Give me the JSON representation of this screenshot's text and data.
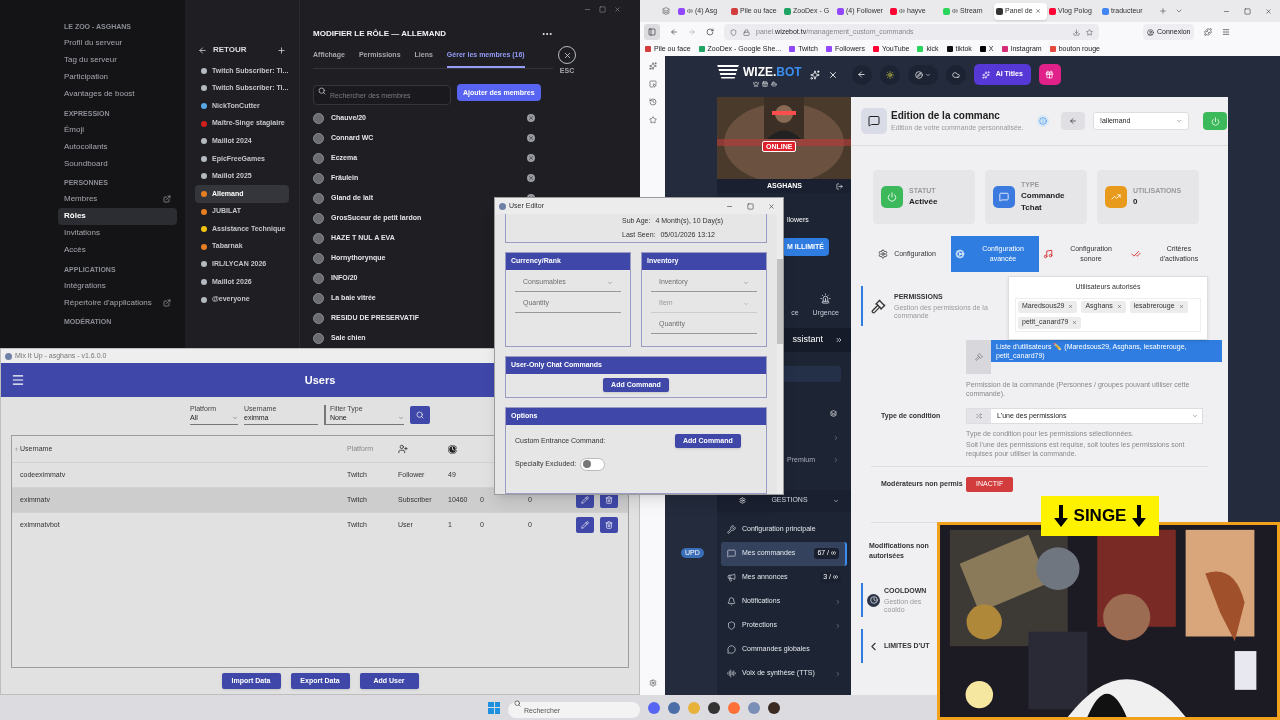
{
  "discord": {
    "sections": [
      {
        "title": "LE ZOO - ASGHANS",
        "items": [
          {
            "label": "Profil du serveur",
            "selected": false,
            "external": false
          },
          {
            "label": "Tag du serveur",
            "selected": false,
            "external": false
          },
          {
            "label": "Participation",
            "selected": false,
            "external": false
          },
          {
            "label": "Avantages de boost",
            "selected": false,
            "external": false
          }
        ]
      },
      {
        "title": "EXPRESSION",
        "items": [
          {
            "label": "Émoji",
            "selected": false,
            "external": false
          },
          {
            "label": "Autocollants",
            "selected": false,
            "external": false
          },
          {
            "label": "Soundboard",
            "selected": false,
            "external": false
          }
        ]
      },
      {
        "title": "PERSONNES",
        "items": [
          {
            "label": "Membres",
            "selected": false,
            "external": true
          },
          {
            "label": "Rôles",
            "selected": true,
            "external": false
          },
          {
            "label": "Invitations",
            "selected": false,
            "external": false
          },
          {
            "label": "Accès",
            "selected": false,
            "external": false
          }
        ]
      },
      {
        "title": "APPLICATIONS",
        "items": [
          {
            "label": "Intégrations",
            "selected": false,
            "external": false
          },
          {
            "label": "Répertoire d'applications",
            "selected": false,
            "external": true
          }
        ]
      },
      {
        "title": "MODÉRATION"
      }
    ],
    "back_label": "RETOUR",
    "roles": [
      {
        "name": "Twitch Subscriber: Ti...",
        "color": "#b5bac1",
        "selected": false
      },
      {
        "name": "Twitch Subscriber: Ti...",
        "color": "#b5bac1",
        "selected": false
      },
      {
        "name": "NickTonCutter",
        "color": "#5aa9e6",
        "selected": false
      },
      {
        "name": "Maître-Singe stagiaire",
        "color": "#d41f1f",
        "selected": false
      },
      {
        "name": "Maillot 2024",
        "color": "#b5bac1",
        "selected": false
      },
      {
        "name": "EpicFreeGames",
        "color": "#b5bac1",
        "selected": false
      },
      {
        "name": "Maillot 2025",
        "color": "#b5bac1",
        "selected": false
      },
      {
        "name": "Allemand",
        "color": "#e67e22",
        "selected": true
      },
      {
        "name": "JUBILAT",
        "color": "#e67e22",
        "selected": false
      },
      {
        "name": "Assistance Technique",
        "color": "#f1c40f",
        "selected": false
      },
      {
        "name": "Tabarnak",
        "color": "#e67e22",
        "selected": false
      },
      {
        "name": "IRL/LYCAN 2026",
        "color": "#b5bac1",
        "selected": false
      },
      {
        "name": "Maillot 2026",
        "color": "#b5bac1",
        "selected": false
      },
      {
        "name": "@everyone",
        "color": "#b5bac1",
        "selected": false
      }
    ],
    "editor": {
      "title": "MODIFIER LE RÔLE — ALLEMAND",
      "tabs": [
        {
          "label": "Affichage",
          "selected": false
        },
        {
          "label": "Permissions",
          "selected": false
        },
        {
          "label": "Liens",
          "selected": false
        },
        {
          "label": "Gérer les membres (16)",
          "selected": true
        }
      ],
      "close_hint": "ESC",
      "search": {
        "placeholder": "Rechercher des membres"
      },
      "add_button": "Ajouter des membres",
      "members": [
        {
          "name": "Chauve/20",
          "remove_button": true
        },
        {
          "name": "Connard WC",
          "remove_button": true
        },
        {
          "name": "Eczema",
          "remove_button": true
        },
        {
          "name": "Fräulein",
          "remove_button": true
        },
        {
          "name": "Gland de lait",
          "remove_button": true
        },
        {
          "name": "GrosSuceur de petit lardon",
          "remove_button": false
        },
        {
          "name": "HAZE T NUL A EVA",
          "remove_button": false
        },
        {
          "name": "Hornythorynque",
          "remove_button": false
        },
        {
          "name": "INFO/20",
          "remove_button": false
        },
        {
          "name": "La baie vitrée",
          "remove_button": false
        },
        {
          "name": "RESIDU DE PRESERVATIF",
          "remove_button": false
        },
        {
          "name": "Sale chien",
          "remove_button": false
        }
      ]
    }
  },
  "mixitup": {
    "title": "Mix It Up - asghans - v1.6.0.0",
    "header": "Users",
    "filters": [
      {
        "label": "Platform",
        "value": "All",
        "kind": "select"
      },
      {
        "label": "Username",
        "value": "eximma",
        "kind": "text"
      },
      {
        "label": "Filter Type",
        "value": "None",
        "kind": "select"
      }
    ],
    "columns": [
      {
        "kind": "text",
        "label": "Username"
      },
      {
        "kind": "text",
        "label": "Platform"
      },
      {
        "kind": "follow-icon"
      },
      {
        "kind": "clock-icon"
      }
    ],
    "rows": [
      {
        "selected": false,
        "actions": false,
        "cells": [
          "codeeximmatv",
          "Twitch",
          "Follower",
          "49"
        ]
      },
      {
        "selected": true,
        "actions": true,
        "cells": [
          "eximmatv",
          "Twitch",
          "Subscriber",
          "10460",
          "0",
          "0"
        ]
      },
      {
        "selected": false,
        "actions": true,
        "cells": [
          "eximmatvbot",
          "Twitch",
          "User",
          "1",
          "0",
          "0"
        ]
      }
    ],
    "buttons": [
      "Import Data",
      "Export Data",
      "Add User"
    ]
  },
  "user_editor": {
    "title": "User Editor",
    "details": [
      {
        "label": "Sub Age:",
        "value": "4 Month(s), 10 Day(s)"
      },
      {
        "label": "Last Seen:",
        "value": "05/01/2026 13:12"
      }
    ],
    "panels": [
      {
        "title": "Currency/Rank",
        "fields": [
          {
            "kind": "select",
            "placeholder": "Consumables",
            "disabled": false
          },
          {
            "kind": "text",
            "placeholder": "Quantity",
            "disabled": false
          }
        ]
      },
      {
        "title": "Inventory",
        "fields": [
          {
            "kind": "select",
            "placeholder": "Inventory",
            "disabled": false
          },
          {
            "kind": "select",
            "placeholder": "Item",
            "disabled": true
          },
          {
            "kind": "text",
            "placeholder": "Quantity",
            "disabled": false
          }
        ]
      }
    ],
    "chat_commands": {
      "title": "User-Only Chat Commands",
      "button": "Add Command"
    },
    "options": {
      "title": "Options",
      "rows": [
        {
          "kind": "button",
          "label": "Custom Entrance Command:",
          "button": "Add Command"
        },
        {
          "kind": "toggle",
          "label": "Specialty Excluded:",
          "on": false
        }
      ]
    }
  },
  "browser": {
    "tabs": [
      {
        "label": "(4) Asg",
        "color": "#9146ff",
        "audio": true,
        "selected": false
      },
      {
        "label": "Pile ou face",
        "color": "#d33c3c",
        "audio": false,
        "selected": false
      },
      {
        "label": "ZooDex - G",
        "color": "#1fa463",
        "audio": false,
        "selected": false
      },
      {
        "label": "(4) Follower",
        "color": "#9146ff",
        "audio": false,
        "selected": false
      },
      {
        "label": "hayve",
        "color": "#ff0033",
        "audio": true,
        "selected": false
      },
      {
        "label": "Stream",
        "color": "#2bd45a",
        "audio": true,
        "selected": false
      },
      {
        "label": "Panel de",
        "color": "#333333",
        "audio": false,
        "selected": true
      },
      {
        "label": "Vlog Polog",
        "color": "#ff0033",
        "audio": false,
        "selected": false
      },
      {
        "label": "traducteur",
        "color": "#4285f4",
        "audio": false,
        "selected": false
      }
    ],
    "address": "panel.**wizebot.tv**/management_custom_commands",
    "account": "Connexion",
    "bookmarks": [
      {
        "label": "Pile ou face",
        "color": "#d33c3c"
      },
      {
        "label": "ZooDex - Google She...",
        "color": "#1fa463"
      },
      {
        "label": "Twitch",
        "color": "#9146ff"
      },
      {
        "label": "Followers",
        "color": "#9146ff"
      },
      {
        "label": "YouTube",
        "color": "#ff0033"
      },
      {
        "label": "kick",
        "color": "#2bd45a"
      },
      {
        "label": "tiktok",
        "color": "#111111"
      },
      {
        "label": "X",
        "color": "#000000"
      },
      {
        "label": "Instagram",
        "color": "#d62976"
      },
      {
        "label": "bouton rouge",
        "color": "#e5483f"
      }
    ]
  },
  "wizebot": {
    "logo": {
      "main": "WIZE.",
      "accent": "BOT"
    },
    "ai_button": "AI Titles",
    "profile": {
      "status": "ONLINE",
      "name": "ASGHANS",
      "followers": "llowers",
      "plan": "M ILLIMITÉ",
      "shortcuts": [
        "ce",
        "Urgence"
      ],
      "assistant": "ssistant",
      "premium": "Premium"
    },
    "upd_badge": "UPD",
    "menu": {
      "section": "GESTIONS",
      "items": [
        {
          "kind": "wrench",
          "label": "Configuration principale",
          "selected": false,
          "chevron": false
        },
        {
          "kind": "message",
          "label": "Mes commandes",
          "count": "67 / ∞",
          "selected": true,
          "chevron": false
        },
        {
          "kind": "megaphone",
          "label": "Mes annonces",
          "count": "3 / ∞",
          "selected": false,
          "chevron": false
        },
        {
          "kind": "bell",
          "label": "Notifications",
          "selected": false,
          "chevron": true
        },
        {
          "kind": "shield",
          "label": "Protections",
          "selected": false,
          "chevron": true
        },
        {
          "kind": "chat",
          "label": "Commandes globales",
          "selected": false,
          "chevron": false
        },
        {
          "kind": "audio",
          "label": "Voix de synthèse (TTS)",
          "selected": false,
          "chevron": true
        }
      ]
    },
    "command": {
      "title": "Edition de la commanc",
      "subtitle": "Edition de votre commande personnalisée.",
      "select": "!allemand",
      "stats": [
        {
          "kind": "power",
          "label": "STATUT",
          "value": "Activée",
          "color": "#3cb95a"
        },
        {
          "kind": "message",
          "label": "TYPE",
          "value": "Commande Tchat",
          "color": "#3b7be0"
        },
        {
          "kind": "chart",
          "label": "UTILISATIONS",
          "value": "0",
          "color": "#e89a1c"
        }
      ],
      "tabs": [
        {
          "kind": "gear",
          "label": "Configuration",
          "selected": false
        },
        {
          "kind": "gears",
          "label": "Configuration avancée",
          "selected": true
        },
        {
          "kind": "music",
          "label": "Configuration sonore",
          "selected": false
        },
        {
          "kind": "check",
          "label": "Critères d'activations",
          "selected": false
        }
      ],
      "permissions": {
        "title": "PERMISSIONS",
        "subtitle": "Gestion des permissions de la commande",
        "popup_title": "Utilisateurs autorisés",
        "users": [
          "Maredsous29",
          "Asghans",
          "lesabrerouge",
          "petit_canard79"
        ],
        "value": "Liste d'utilisateurs ✏️ (Maredsous29, Asghans, lesabrerouge, petit_canard79)",
        "help": "Permission de la commande (Personnes / groupes pouvant utiliser cette commande)."
      },
      "condition": {
        "label": "Type de condition",
        "value": "L'une des permissions",
        "help": [
          "Type de condition pour les permissions sélectionnées.",
          "Soit l'une des permissions est requise, soit toutes les permissions sont requises pour utiliser la commande."
        ]
      },
      "moderators": {
        "label": "Modérateurs non permis",
        "value": "INACTIF"
      },
      "modifications": {
        "label": "Modifications non autorisées"
      },
      "sections": [
        {
          "kind": "clock",
          "title": "COOLDOWN",
          "subtitle": "Gestion des cooldo"
        },
        {
          "kind": "limit",
          "title": "LIMITES D'UT"
        }
      ]
    }
  },
  "webcam": {
    "banner": "SINGE"
  },
  "taskbar": {
    "search_placeholder": "Rechercher"
  }
}
